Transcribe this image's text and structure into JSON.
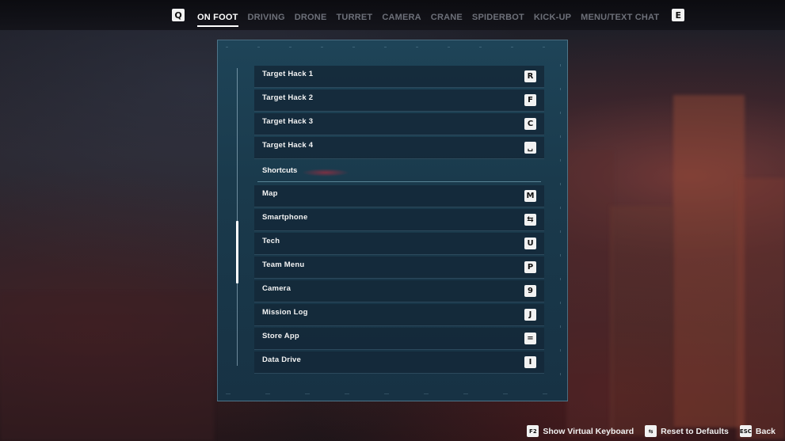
{
  "tabs": {
    "prev_key": "Q",
    "next_key": "E",
    "items": [
      {
        "label": "ON FOOT",
        "active": true
      },
      {
        "label": "DRIVING",
        "active": false
      },
      {
        "label": "DRONE",
        "active": false
      },
      {
        "label": "TURRET",
        "active": false
      },
      {
        "label": "CAMERA",
        "active": false
      },
      {
        "label": "CRANE",
        "active": false
      },
      {
        "label": "SPIDERBOT",
        "active": false
      },
      {
        "label": "KICK-UP",
        "active": false
      },
      {
        "label": "MENU/TEXT CHAT",
        "active": false
      }
    ]
  },
  "bindings": {
    "group1": [
      {
        "action": "Target Hack 1",
        "key": "R",
        "key_icon": "r-key"
      },
      {
        "action": "Target Hack 2",
        "key": "F",
        "key_icon": "f-key"
      },
      {
        "action": "Target Hack 3",
        "key": "C",
        "key_icon": "c-key"
      },
      {
        "action": "Target Hack 4",
        "key": "␣",
        "key_icon": "space-key-icon"
      }
    ],
    "section_title": "Shortcuts",
    "shortcuts": [
      {
        "action": "Map",
        "key": "M",
        "key_icon": "m-key"
      },
      {
        "action": "Smartphone",
        "key": "⇆",
        "key_icon": "tab-key-icon"
      },
      {
        "action": "Tech",
        "key": "U",
        "key_icon": "u-key"
      },
      {
        "action": "Team Menu",
        "key": "P",
        "key_icon": "p-key"
      },
      {
        "action": "Camera",
        "key": "9",
        "key_icon": "9-key"
      },
      {
        "action": "Mission Log",
        "key": "J",
        "key_icon": "j-key"
      },
      {
        "action": "Store App",
        "key": "=",
        "key_icon": "equals-key"
      },
      {
        "action": "Data Drive",
        "key": "I",
        "key_icon": "i-key"
      }
    ]
  },
  "scroll": {
    "position_fraction": 0.65,
    "visible_fraction": 0.21
  },
  "footer": {
    "hints": [
      {
        "key": "F2",
        "label": "Show Virtual Keyboard",
        "icon": "f2-key-icon"
      },
      {
        "key": "⇆",
        "label": "Reset to Defaults",
        "icon": "tab-key-icon"
      },
      {
        "key": "ESC",
        "label": "Back",
        "icon": "esc-key-icon"
      }
    ]
  }
}
